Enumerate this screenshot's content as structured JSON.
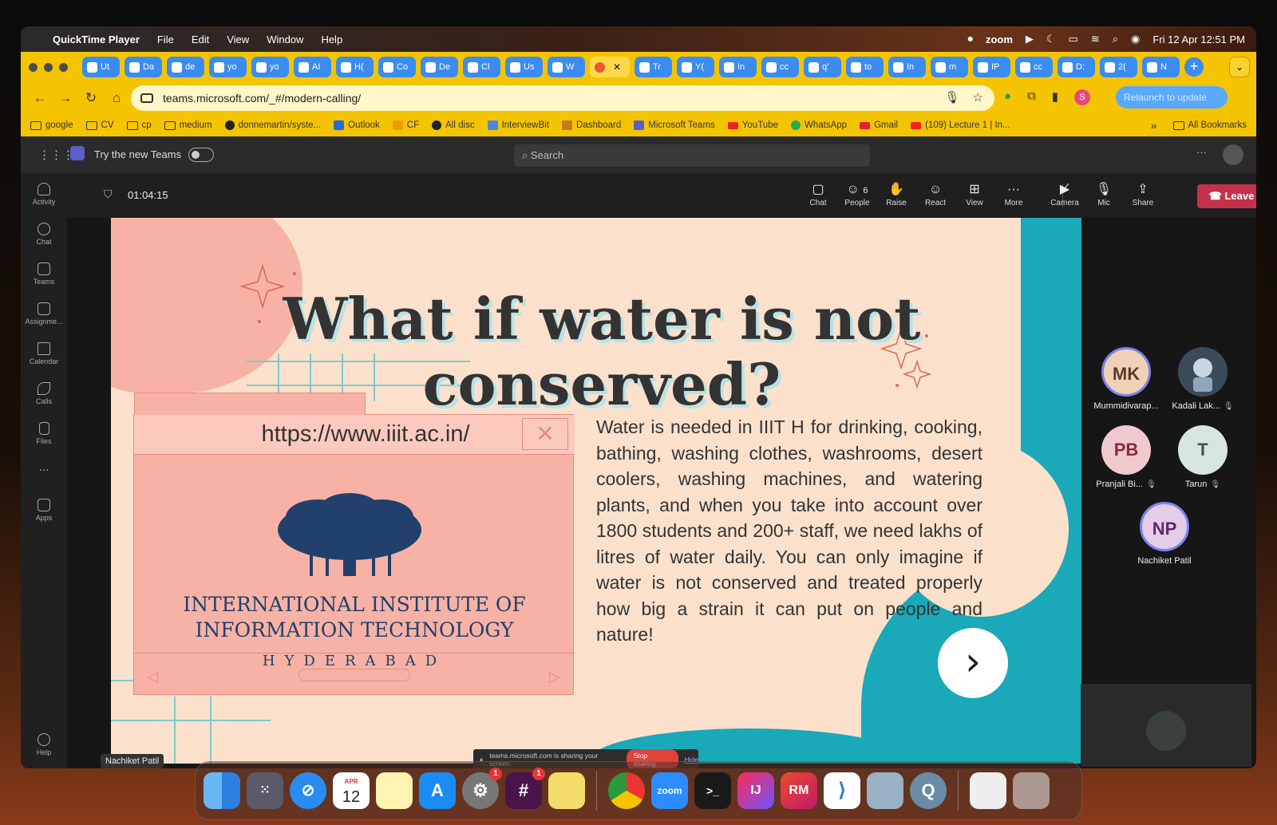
{
  "menubar": {
    "app": "QuickTime Player",
    "menus": [
      "File",
      "Edit",
      "View",
      "Window",
      "Help"
    ],
    "zoom_label": "zoom",
    "datetime": "Fri 12 Apr  12:51 PM"
  },
  "browser": {
    "tabs": [
      "Ut",
      "Da",
      "de",
      "yo",
      "yo",
      "AI",
      "H(",
      "Co",
      "De",
      "Cl",
      "Us",
      "W",
      "",
      "Tr",
      "Y(",
      "In",
      "cc",
      "q'",
      "to",
      "In",
      "m",
      "IP",
      "cc",
      "D:",
      "2(",
      "N"
    ],
    "active_tab_index": 12,
    "url": "teams.microsoft.com/_#/modern-calling/",
    "relaunch": "Relaunch to update",
    "profile_initial": "S",
    "bookmarks": [
      "google",
      "CV",
      "cp",
      "medium",
      "donnemartin/syste...",
      "Outlook",
      "CF",
      "All disc",
      "InterviewBit",
      "Dashboard",
      "Microsoft Teams",
      "YouTube",
      "WhatsApp",
      "Gmail",
      "(109) Lecture 1 | In..."
    ],
    "bookmarks_more": "»",
    "all_bookmarks": "All Bookmarks"
  },
  "teams": {
    "try_new": "Try the new Teams",
    "search_placeholder": "Search",
    "rail": [
      "Activity",
      "Chat",
      "Teams",
      "Assignme...",
      "Calendar",
      "Calls",
      "Files",
      "...",
      "Apps"
    ],
    "help": "Help",
    "timer": "01:04:15",
    "controls": {
      "chat": "Chat",
      "people": "People",
      "people_count": "6",
      "raise": "Raise",
      "react": "React",
      "view": "View",
      "more": "More",
      "camera": "Camera",
      "mic": "Mic",
      "share": "Share",
      "leave": "Leave"
    },
    "participants": [
      {
        "initials": "MK",
        "name": "Mummidivarap...",
        "bg": "#f1d1b6",
        "fg": "#5a3a2a",
        "ring": "#7b83eb"
      },
      {
        "initials": "",
        "name": "Kadali Lak...",
        "bg": "#3c4b5a",
        "fg": "#fff",
        "ring": ""
      },
      {
        "initials": "PB",
        "name": "Pranjali Bi...",
        "bg": "#f0c9cf",
        "fg": "#8a2a3a",
        "ring": ""
      },
      {
        "initials": "T",
        "name": "Tarun",
        "bg": "#d6e5de",
        "fg": "#3a5a4a",
        "ring": ""
      },
      {
        "initials": "NP",
        "name": "Nachiket Patil",
        "bg": "#e6cce9",
        "fg": "#5a2a6a",
        "ring": "#7b83eb"
      }
    ],
    "presenter_tag": "Nachiket Patil",
    "share_notice": "teams.microsoft.com is sharing your screen.",
    "stop_sharing": "Stop sharing",
    "hide": "Hide"
  },
  "slide": {
    "title": "What if water is not conserved?",
    "url": "https://www.iiit.ac.in/",
    "close_x": "✕",
    "institute_line1": "INTERNATIONAL INSTITUTE OF",
    "institute_line2": "INFORMATION TECHNOLOGY",
    "institute_city": "HYDERABAD",
    "body": "Water is needed in IIIT H for drinking, cooking, bathing, washing clothes, washrooms, desert coolers, washing machines, and watering plants, and when you take into account over 1800 students and 200+ staff, we need lakhs of litres of water daily. You can only imagine if water is not conserved and treated properly how big a strain it can put on people and nature!",
    "next": "›"
  },
  "dock": {
    "calendar_month": "APR",
    "calendar_day": "12",
    "badges": [
      "1",
      "1"
    ],
    "labels": [
      "zoom",
      "IJ",
      "RM"
    ]
  },
  "colors": {
    "browser_yellow": "#f5c400",
    "tab_blue": "#3b8cf0",
    "leave_red": "#c4314b",
    "slide_teal": "#19a9b9",
    "slide_pink": "#f7b2a5",
    "slide_cream": "#fbe1cc",
    "iiit_navy": "#21406b"
  }
}
